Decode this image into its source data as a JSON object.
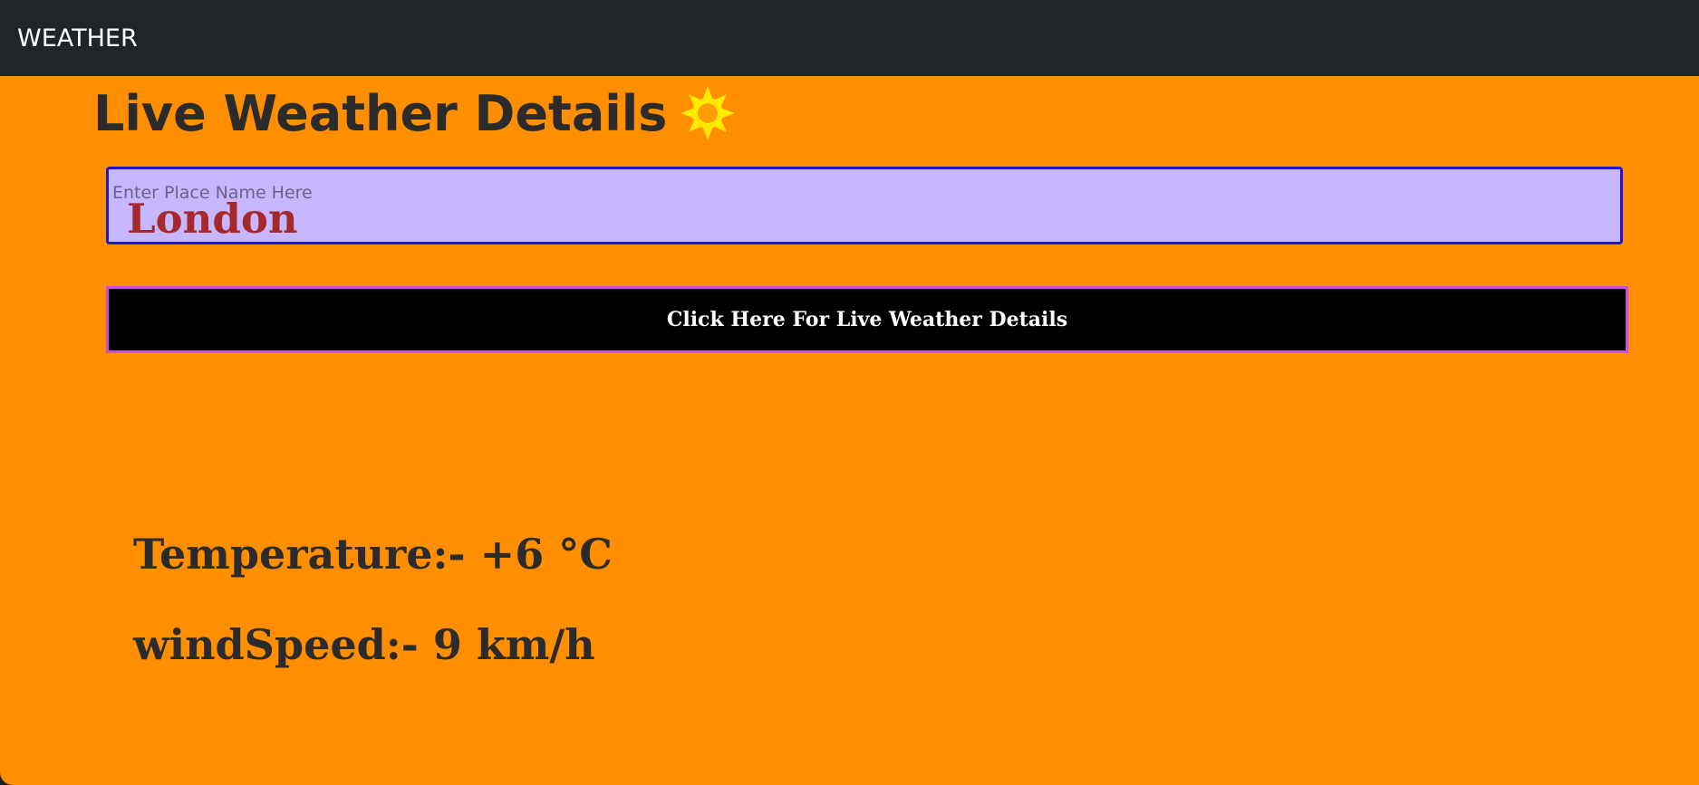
{
  "navbar": {
    "brand": "WEATHER"
  },
  "main": {
    "heading": "Live Weather Details",
    "heading_icon": "sun-icon",
    "search": {
      "placeholder": "Enter Place Name Here",
      "value": "London"
    },
    "submit_label": "Click Here For Live Weather Details",
    "results": {
      "temperature_text": "Temperature:- +6 °C",
      "wind_speed_text": "windSpeed:- 9 km/h"
    }
  },
  "colors": {
    "navbar_bg": "#212529",
    "page_bg": "#ff8f00",
    "input_bg": "#c6b7ff",
    "input_border": "#2412d6",
    "input_value": "#a5282d",
    "button_bg": "#000000",
    "button_border": "#d04ae8",
    "sun": "#ffea00"
  }
}
